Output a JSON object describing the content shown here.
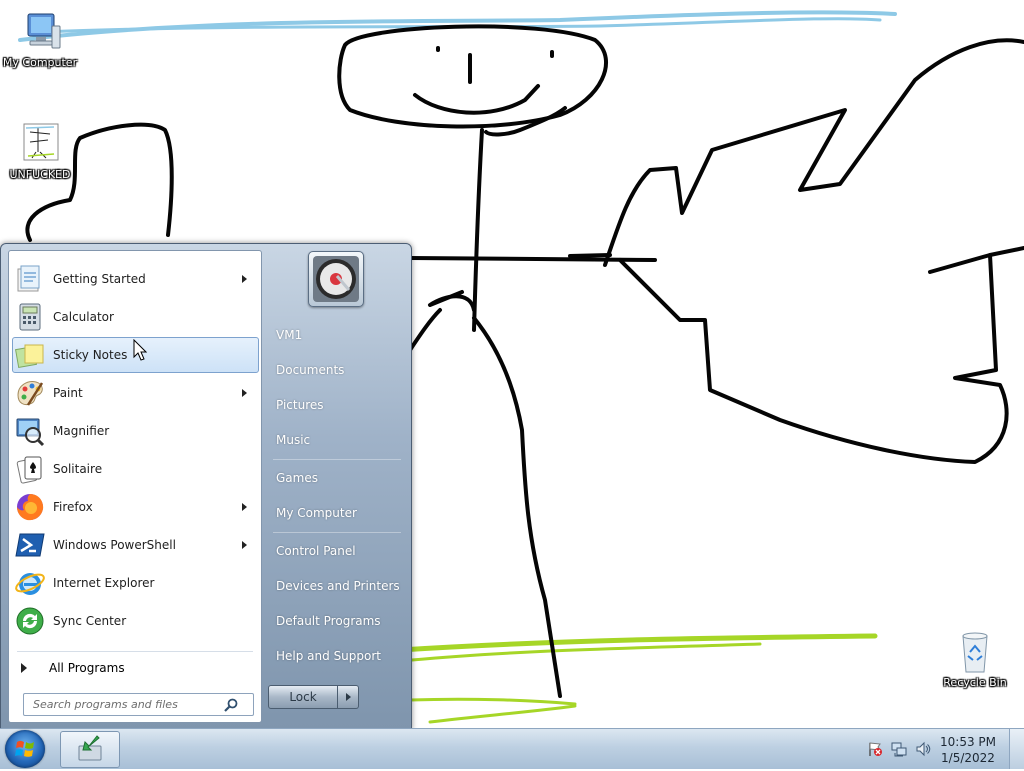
{
  "desktop": {
    "icons": [
      {
        "label": "My Computer",
        "icon": "computer-icon"
      },
      {
        "label": "UNFUCKED",
        "icon": "image-file-icon"
      },
      {
        "label": "Recycle Bin",
        "icon": "recycle-bin-icon"
      }
    ]
  },
  "start_menu": {
    "programs": [
      {
        "label": "Getting Started",
        "icon": "getting-started-icon",
        "has_submenu": true
      },
      {
        "label": "Calculator",
        "icon": "calculator-icon",
        "has_submenu": false
      },
      {
        "label": "Sticky Notes",
        "icon": "sticky-notes-icon",
        "has_submenu": false,
        "highlighted": true
      },
      {
        "label": "Paint",
        "icon": "paint-icon",
        "has_submenu": true
      },
      {
        "label": "Magnifier",
        "icon": "magnifier-icon",
        "has_submenu": false
      },
      {
        "label": "Solitaire",
        "icon": "solitaire-icon",
        "has_submenu": false
      },
      {
        "label": "Firefox",
        "icon": "firefox-icon",
        "has_submenu": true
      },
      {
        "label": "Windows PowerShell",
        "icon": "powershell-icon",
        "has_submenu": true
      },
      {
        "label": "Internet Explorer",
        "icon": "internet-explorer-icon",
        "has_submenu": false
      },
      {
        "label": "Sync Center",
        "icon": "sync-center-icon",
        "has_submenu": false
      }
    ],
    "all_programs_label": "All Programs",
    "search_placeholder": "Search programs and files",
    "right_items": [
      {
        "label": "VM1"
      },
      {
        "label": "Documents"
      },
      {
        "label": "Pictures"
      },
      {
        "label": "Music"
      },
      {
        "label": "Games"
      },
      {
        "label": "My Computer"
      },
      {
        "label": "Control Panel"
      },
      {
        "label": "Devices and Printers"
      },
      {
        "label": "Default Programs"
      },
      {
        "label": "Help and Support"
      }
    ],
    "lock_label": "Lock"
  },
  "taskbar": {
    "time": "10:53 PM",
    "date": "1/5/2022",
    "tray_icons": [
      "action-center-flag-icon",
      "network-icon",
      "volume-icon"
    ]
  }
}
